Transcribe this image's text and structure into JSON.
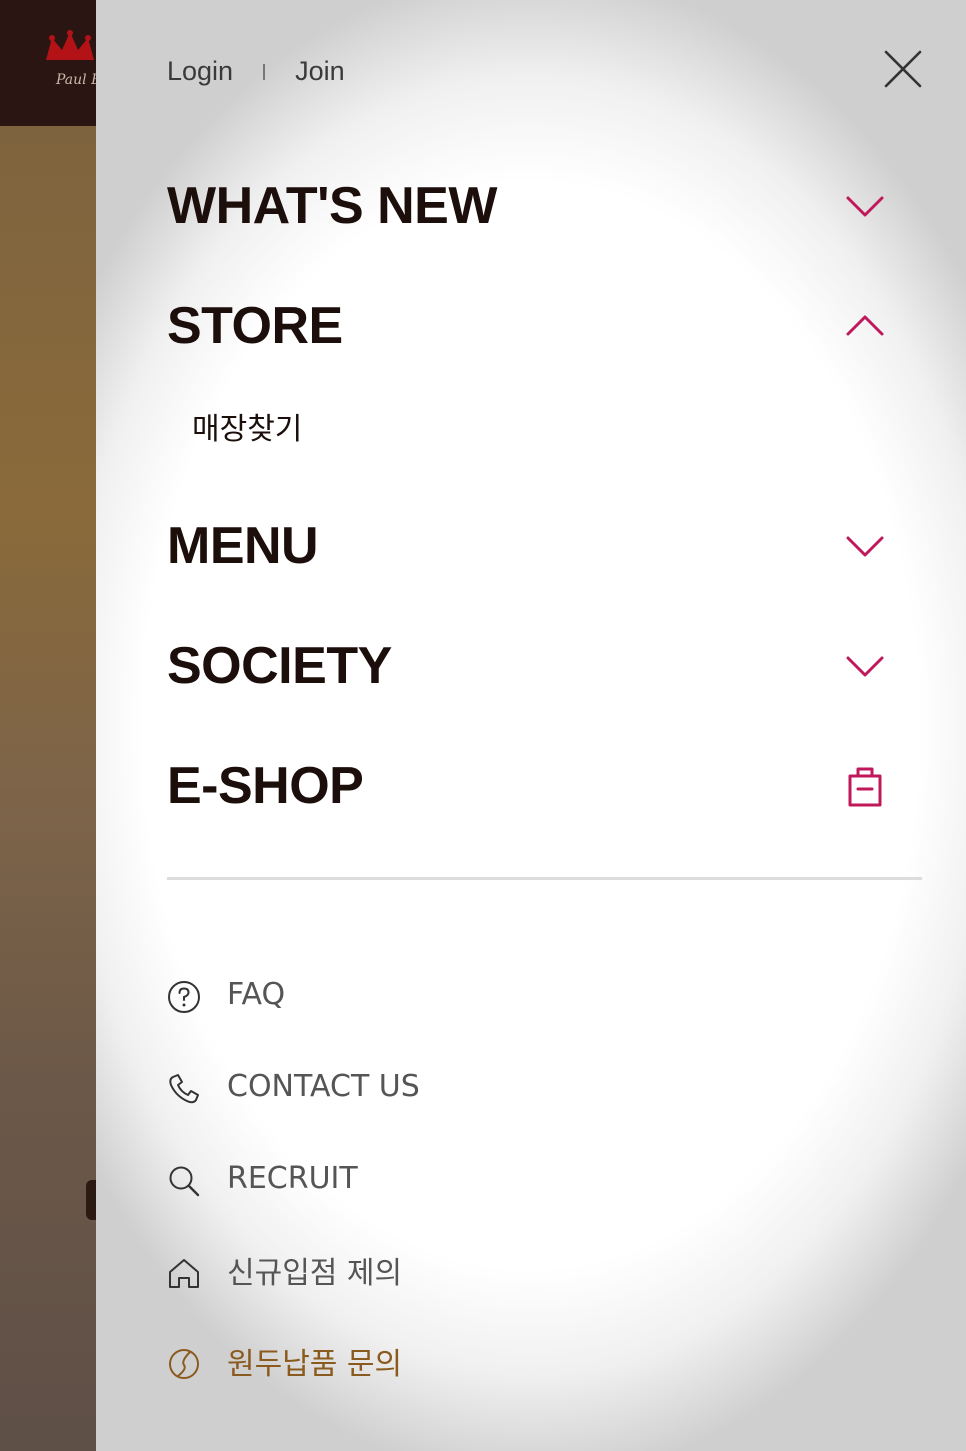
{
  "auth": {
    "login": "Login",
    "join": "Join"
  },
  "nav": {
    "items": [
      {
        "label": "WHAT'S NEW",
        "icon": "chevron-down-icon"
      },
      {
        "label": "STORE",
        "icon": "chevron-up-icon",
        "expanded": true
      },
      {
        "label": "MENU",
        "icon": "chevron-down-icon"
      },
      {
        "label": "SOCIETY",
        "icon": "chevron-down-icon"
      },
      {
        "label": "E-SHOP",
        "icon": "shopping-bag-icon"
      }
    ],
    "store_sub": [
      {
        "label": "매장찾기"
      }
    ]
  },
  "utility": {
    "items": [
      {
        "label": "FAQ",
        "icon": "question-circle-icon"
      },
      {
        "label": "CONTACT US",
        "icon": "phone-icon"
      },
      {
        "label": "RECRUIT",
        "icon": "search-icon"
      },
      {
        "label": "신규입점 제의",
        "icon": "home-icon"
      },
      {
        "label": "원두납품 문의",
        "icon": "coffee-bean-icon"
      }
    ]
  },
  "background": {
    "logo_text": "Paul B"
  },
  "colors": {
    "accent": "#c0185a",
    "heading": "#1b0e0b",
    "utility_text": "#555555",
    "brown_text": "#8a5a1e",
    "header_bg": "#2a1512"
  }
}
